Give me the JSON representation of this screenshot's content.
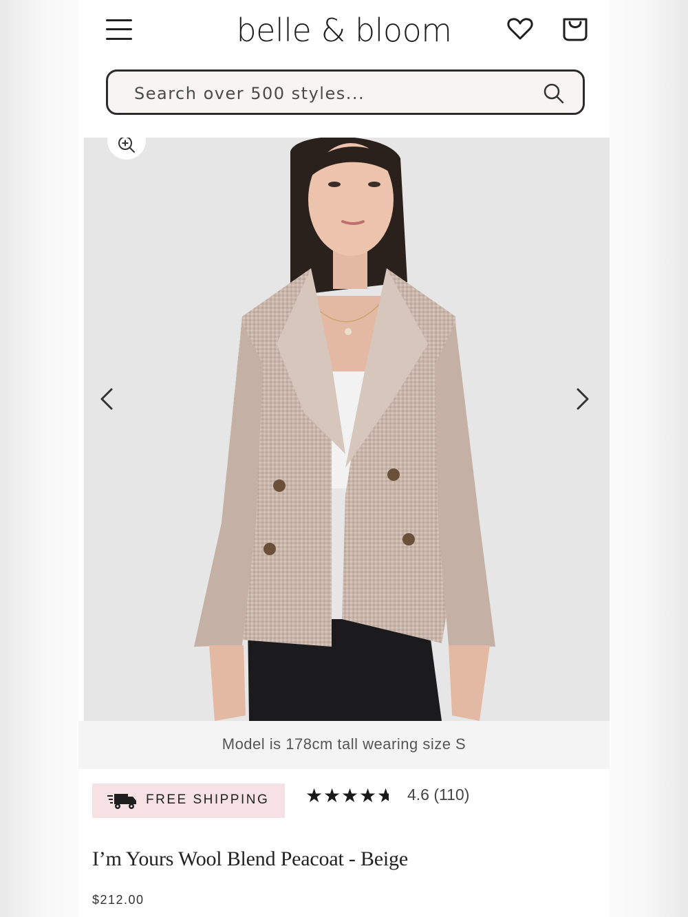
{
  "header": {
    "brand": "belle & bloom",
    "menu_icon": "hamburger-menu-icon",
    "wishlist_icon": "heart-icon",
    "bag_icon": "shopping-bag-icon"
  },
  "search": {
    "placeholder": "Search over 500 styles...",
    "icon": "search-icon"
  },
  "gallery": {
    "image_alt": "Model wearing beige wool blend peacoat",
    "zoom_icon": "zoom-in-icon",
    "prev_icon": "chevron-left-icon",
    "next_icon": "chevron-right-icon",
    "caption": "Model is 178cm tall wearing size S"
  },
  "product": {
    "shipping_label": "FREE SHIPPING",
    "shipping_icon": "truck-icon",
    "rating_value": 4.6,
    "rating_text": "4.6 (110)",
    "title": "I’m Yours Wool Blend Peacoat - Beige",
    "price": "$212.00"
  },
  "colors": {
    "accent_badge": "#f6e2e4",
    "text": "#222222",
    "coat": "#c9b6ab",
    "photo_bg": "#e6e6e6"
  }
}
